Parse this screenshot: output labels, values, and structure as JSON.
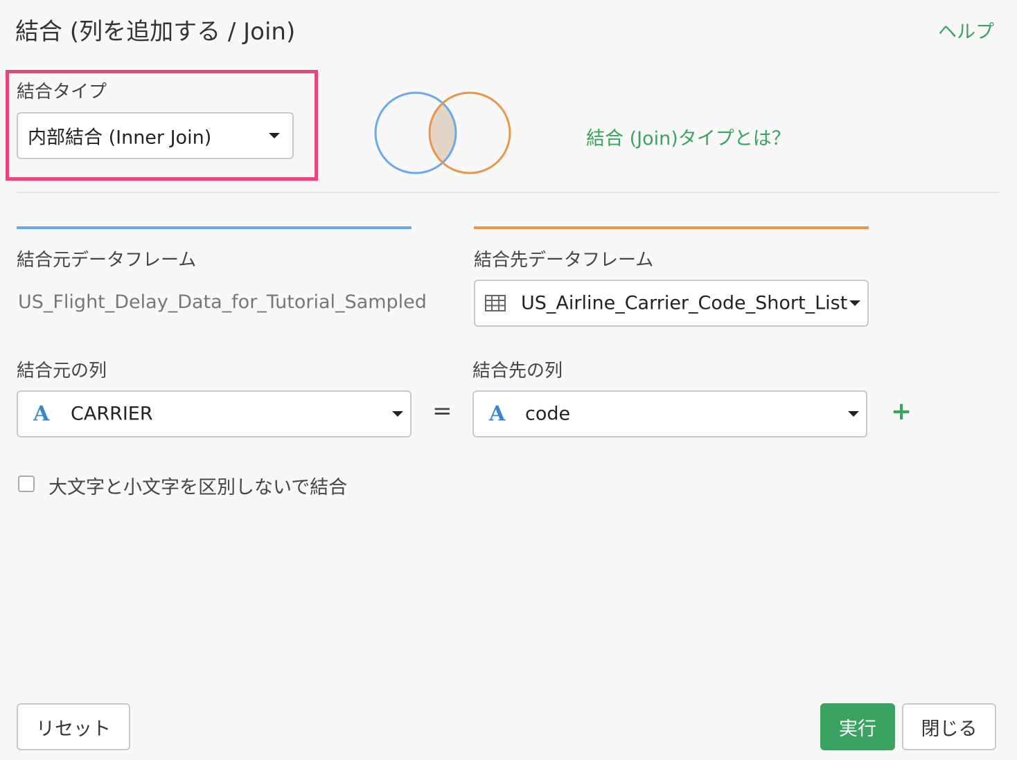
{
  "dialog": {
    "title": "結合 (列を追加する / Join)",
    "help_link": "ヘルプ"
  },
  "join_type": {
    "label": "結合タイプ",
    "selected": "内部結合 (Inner Join)",
    "info_link": "結合 (Join)タイプとは？"
  },
  "venn": {
    "left_color": "#6aaae8",
    "right_color": "#e6964d",
    "intersection_color": "#e3d6c8"
  },
  "source": {
    "dataframe_label": "結合元データフレーム",
    "dataframe_name": "US_Flight_Delay_Data_for_Tutorial_Sampled",
    "column_label": "結合元の列",
    "column_type_icon": "A",
    "column_selected": "CARRIER",
    "accent_color": "#6aaae8"
  },
  "target": {
    "dataframe_label": "結合先データフレーム",
    "dataframe_selected": "US_Airline_Carrier_Code_Short_List",
    "column_label": "結合先の列",
    "column_type_icon": "A",
    "column_selected": "code",
    "accent_color": "#e6964d"
  },
  "operators": {
    "equals": "=",
    "add": "+"
  },
  "case_insensitive": {
    "label": "大文字と小文字を区別しないで結合",
    "checked": false
  },
  "footer": {
    "reset_label": "リセット",
    "run_label": "実行",
    "close_label": "閉じる"
  }
}
